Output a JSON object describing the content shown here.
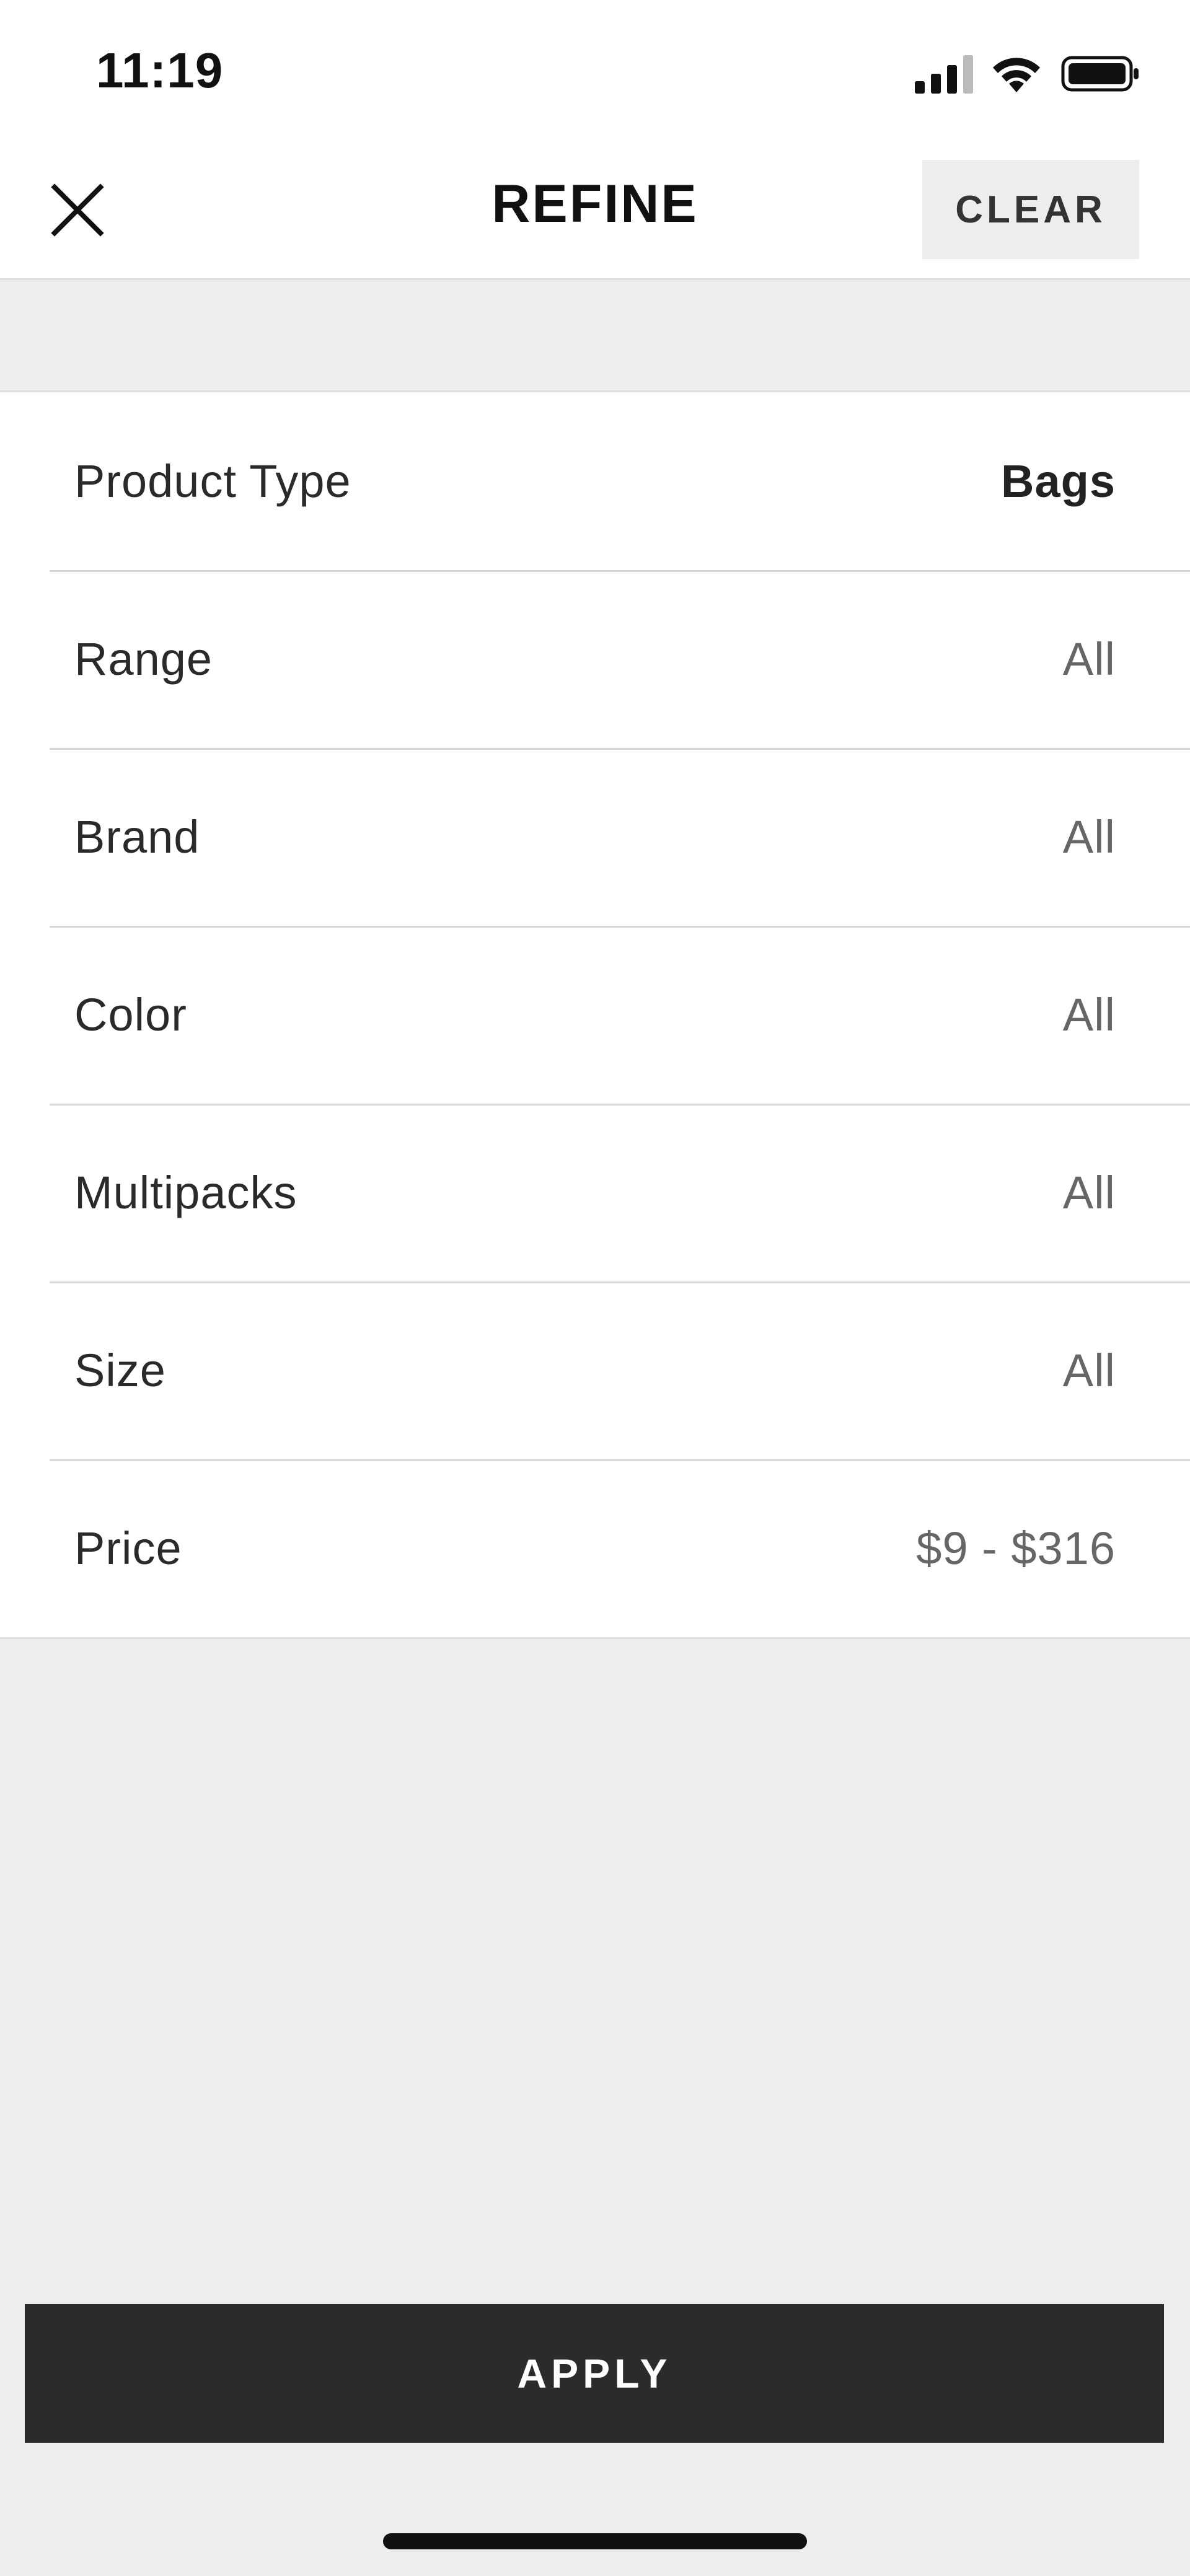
{
  "status_bar": {
    "time": "11:19"
  },
  "header": {
    "title": "REFINE",
    "clear_label": "CLEAR"
  },
  "filters": [
    {
      "label": "Product Type",
      "value": "Bags",
      "selected": true
    },
    {
      "label": "Range",
      "value": "All",
      "selected": false
    },
    {
      "label": "Brand",
      "value": "All",
      "selected": false
    },
    {
      "label": "Color",
      "value": "All",
      "selected": false
    },
    {
      "label": "Multipacks",
      "value": "All",
      "selected": false
    },
    {
      "label": "Size",
      "value": "All",
      "selected": false
    },
    {
      "label": "Price",
      "value": "$9 - $316",
      "selected": false
    }
  ],
  "footer": {
    "apply_label": "APPLY"
  },
  "icons": {
    "close": "close-icon",
    "signal": "cellular-signal-icon",
    "wifi": "wifi-icon",
    "battery": "battery-icon"
  },
  "colors": {
    "background": "#ededed",
    "surface": "#ffffff",
    "apply_button": "#2b2b2b",
    "selected_value": "#222222",
    "muted_value": "#666666"
  }
}
